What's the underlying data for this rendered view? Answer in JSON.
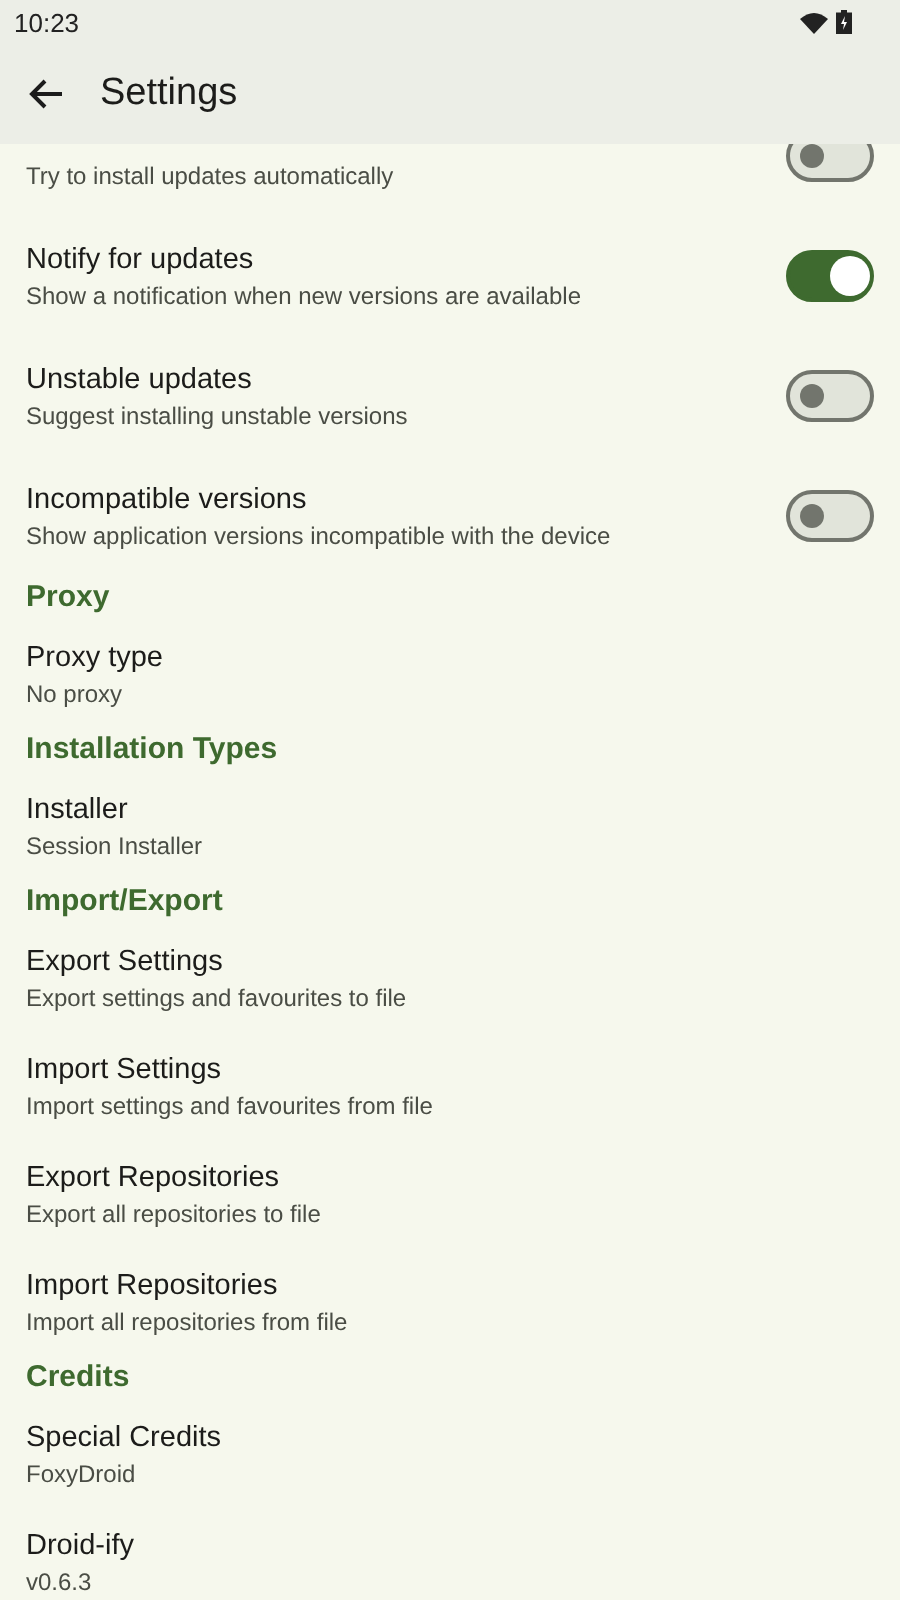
{
  "status_bar": {
    "time": "10:23"
  },
  "app_bar": {
    "title": "Settings"
  },
  "sections": [
    {
      "items": [
        {
          "kind": "switch",
          "subtitle": "Try to install updates automatically",
          "on": false
        },
        {
          "kind": "switch",
          "title": "Notify for updates",
          "subtitle": "Show a notification when new versions are available",
          "on": true
        },
        {
          "kind": "switch",
          "title": "Unstable updates",
          "subtitle": "Suggest installing unstable versions",
          "on": false
        },
        {
          "kind": "switch",
          "title": "Incompatible versions",
          "subtitle": "Show application versions incompatible with the device",
          "on": false
        }
      ]
    },
    {
      "header": "Proxy",
      "items": [
        {
          "kind": "plain",
          "title": "Proxy type",
          "subtitle": "No proxy"
        }
      ]
    },
    {
      "header": "Installation Types",
      "items": [
        {
          "kind": "plain",
          "title": "Installer",
          "subtitle": "Session Installer"
        }
      ]
    },
    {
      "header": "Import/Export",
      "items": [
        {
          "kind": "plain",
          "title": "Export Settings",
          "subtitle": "Export settings and favourites to file"
        },
        {
          "kind": "plain",
          "title": "Import Settings",
          "subtitle": "Import settings and favourites from file"
        },
        {
          "kind": "plain",
          "title": "Export Repositories",
          "subtitle": "Export all repositories to file"
        },
        {
          "kind": "plain",
          "title": "Import Repositories",
          "subtitle": "Import all repositories from file"
        }
      ]
    },
    {
      "header": "Credits",
      "items": [
        {
          "kind": "plain",
          "title": "Special Credits",
          "subtitle": "FoxyDroid"
        },
        {
          "kind": "plain",
          "title": "Droid-ify",
          "subtitle": "v0.6.3"
        }
      ]
    }
  ]
}
